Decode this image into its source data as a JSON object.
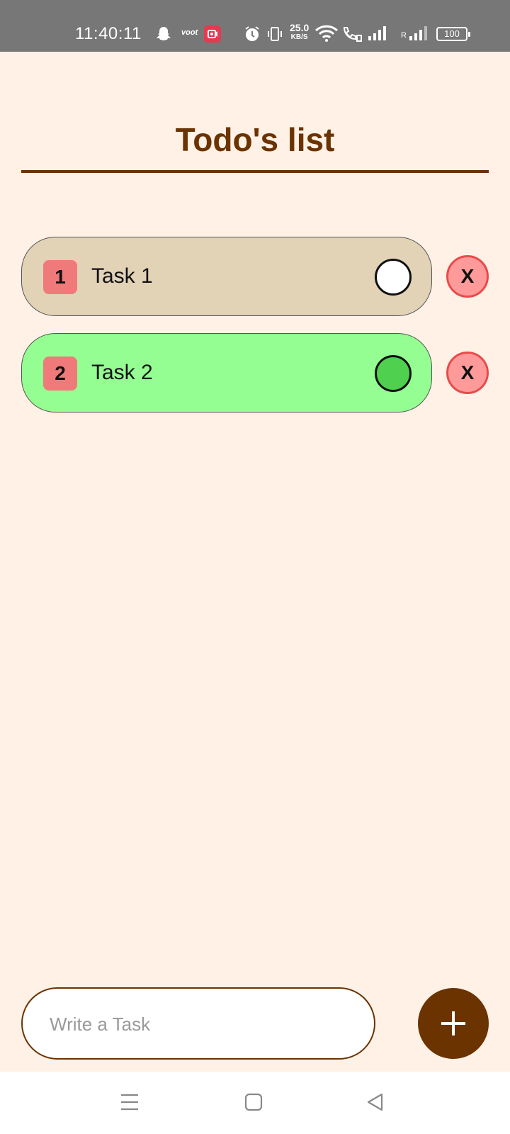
{
  "status_bar": {
    "time": "11:40:11",
    "app_badge": "voot",
    "net_speed_value": "25.0",
    "net_speed_unit": "KB/S",
    "signal_label": "R",
    "battery": "100",
    "icons": [
      "snapchat-icon",
      "voot-icon",
      "screen-record-icon",
      "alarm-icon",
      "vibrate-icon",
      "wifi-icon",
      "wifi-call-icon",
      "signal-icon",
      "signal-roaming-icon",
      "battery-icon"
    ]
  },
  "header": {
    "title": "Todo's list"
  },
  "tasks": [
    {
      "number": "1",
      "text": "Task 1",
      "completed": false,
      "card_color": "#E2D2B6",
      "check_fill": "#FFFFFF",
      "delete_label": "X"
    },
    {
      "number": "2",
      "text": "Task 2",
      "completed": true,
      "card_color": "#94FE92",
      "check_fill": "#4FD04F",
      "delete_label": "X"
    }
  ],
  "composer": {
    "placeholder": "Write a Task",
    "add_icon": "plus-icon"
  },
  "nav_bar": {
    "icons": [
      "menu-icon",
      "home-icon",
      "back-icon"
    ]
  },
  "colors": {
    "background": "#FFF1E6",
    "accent_brown": "#6B3300",
    "badge_red": "#F07A7A",
    "delete_bg": "#FF9A9A",
    "delete_border": "#E84B4B"
  }
}
